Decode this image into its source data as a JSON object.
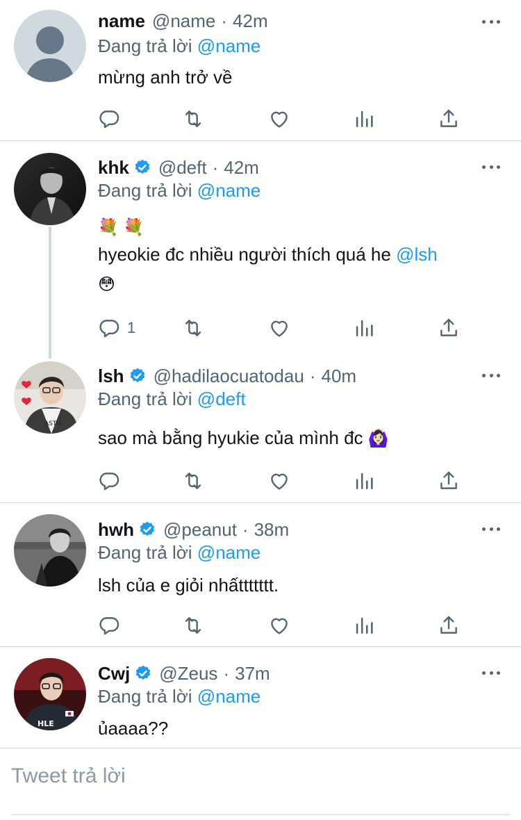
{
  "reply_label": "Đang trả lời",
  "tweets": [
    {
      "name": "name",
      "verified": false,
      "handle": "@name",
      "time": "42m",
      "replying_to": "@name",
      "text_lines": [
        "mừng anh trở về"
      ],
      "reply_count": ""
    },
    {
      "name": "khk",
      "verified": true,
      "handle": "@deft",
      "time": "42m",
      "replying_to": "@name",
      "emoji_line": "💐 💐",
      "text_main": "hyeokie đc nhiều người thích quá he ",
      "text_mention": "@lsh",
      "text_emoji": "😳",
      "reply_count": "1"
    },
    {
      "name": "lsh",
      "verified": true,
      "handle": "@hadilaocuatodau",
      "time": "40m",
      "replying_to": "@deft",
      "text": "sao mà bằng hyukie  của mình đc",
      "text_emoji": "🙆🏻‍♀️",
      "reply_count": ""
    },
    {
      "name": "hwh",
      "verified": true,
      "handle": "@peanut",
      "time": "38m",
      "replying_to": "@name",
      "text": "lsh của e giỏi nhấttttttt.",
      "reply_count": ""
    },
    {
      "name": "Cwj",
      "verified": true,
      "handle": "@Zeus",
      "time": "37m",
      "replying_to": "@name",
      "text": "ủaaaa??",
      "reply_count": ""
    }
  ],
  "composer": {
    "placeholder": "Tweet trả lời"
  },
  "colors": {
    "accent": "#1d9bf0",
    "secondary_text": "#536471",
    "divider": "#cfd9de"
  },
  "icons": [
    "reply-icon",
    "retweet-icon",
    "like-icon",
    "analytics-icon",
    "share-icon",
    "more-icon",
    "verified-badge-icon"
  ]
}
